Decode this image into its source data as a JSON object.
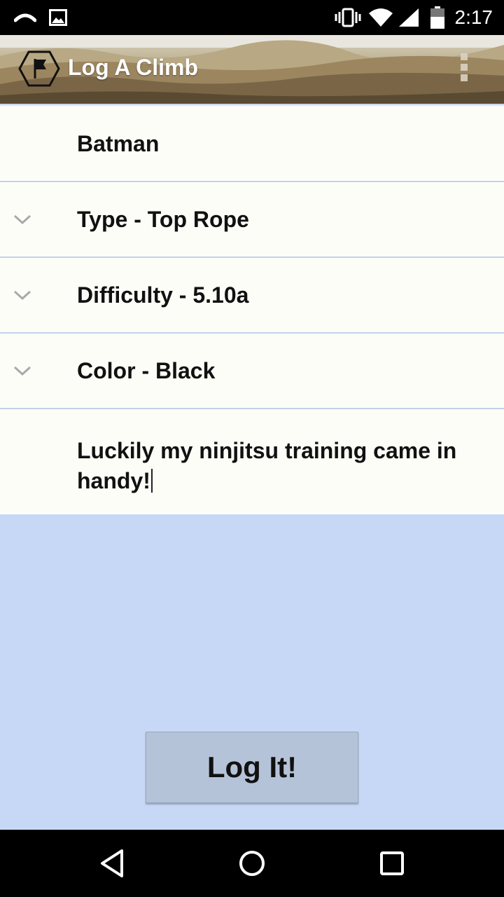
{
  "status_bar": {
    "time": "2:17"
  },
  "action_bar": {
    "title": "Log A Climb",
    "icon": "flag-hexagon-icon",
    "overflow_icon": "overflow-menu-icon"
  },
  "form": {
    "name": "Batman",
    "type_label": "Type - Top Rope",
    "difficulty_label": "Difficulty - 5.10a",
    "color_label": "Color - Black",
    "notes": "Luckily my ninjitsu training came in handy!"
  },
  "button": {
    "label": "Log It!"
  },
  "colors": {
    "background": "#c6d8f5",
    "form_background": "#fdfdf8",
    "divider": "#c4d2ea",
    "button": "#b5c3d8"
  },
  "nav_bar": {
    "back_icon": "back-triangle-icon",
    "home_icon": "home-circle-icon",
    "recents_icon": "recents-square-icon"
  }
}
